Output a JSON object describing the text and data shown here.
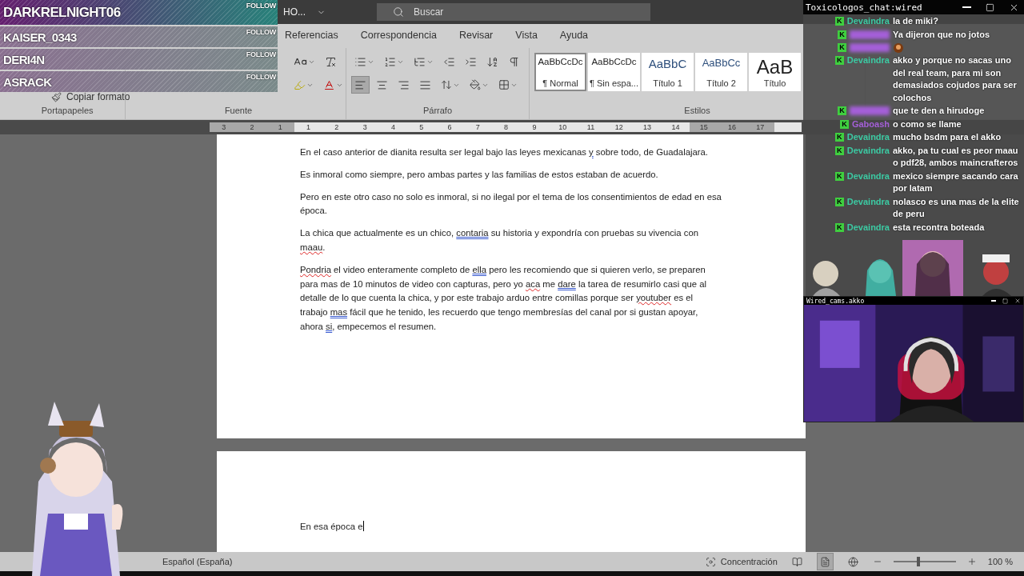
{
  "stream_overlay": {
    "followers": [
      {
        "name": "DARKRELNIGHT06",
        "action": "FOLLOW"
      },
      {
        "name": "KAISER_0343",
        "action": "FOLLOW"
      },
      {
        "name": "DERI4N",
        "action": "FOLLOW"
      },
      {
        "name": "ASRACK",
        "action": "FOLLOW"
      }
    ]
  },
  "word": {
    "account_menu": "HO...",
    "search": {
      "placeholder": "Buscar"
    },
    "tabs": [
      {
        "label": "Referencias",
        "selected": false
      },
      {
        "label": "Correspondencia",
        "selected": false
      },
      {
        "label": "Revisar",
        "selected": false
      },
      {
        "label": "Vista",
        "selected": false
      },
      {
        "label": "Ayuda",
        "selected": false
      }
    ],
    "ribbon": {
      "clipboard": {
        "title": "Portapapeles",
        "commands": [
          "Copiar formato"
        ]
      },
      "font": {
        "title": "Fuente"
      },
      "paragraph": {
        "title": "Párrafo",
        "alignments": [
          {
            "selected": true
          },
          {
            "selected": false
          },
          {
            "selected": false
          },
          {
            "selected": false
          }
        ]
      },
      "styles": {
        "title": "Estilos",
        "items": [
          {
            "preview": "AaBbCcDc",
            "label": "¶ Normal",
            "kind": "body",
            "selected": true
          },
          {
            "preview": "AaBbCcDc",
            "label": "¶ Sin espa...",
            "kind": "body",
            "selected": false
          },
          {
            "preview": "AaBbC",
            "label": "Título 1",
            "kind": "heading1",
            "selected": false
          },
          {
            "preview": "AaBbCc",
            "label": "Título 2",
            "kind": "heading2",
            "selected": false
          },
          {
            "preview": "AaB",
            "label": "Título",
            "kind": "title",
            "selected": false
          }
        ]
      }
    },
    "ruler": [
      "3",
      "2",
      "1",
      "1",
      "2",
      "3",
      "4",
      "5",
      "6",
      "7",
      "8",
      "9",
      "10",
      "11",
      "12",
      "13",
      "14",
      "15",
      "16",
      "17"
    ],
    "pages": [
      {
        "paragraphs": [
          [
            {
              "text": "En el caso anterior de dianita resulta ser legal bajo las leyes mexicanas "
            },
            {
              "text": "y",
              "grammar_flag": true
            },
            {
              "text": " sobre todo, de Guadalajara."
            }
          ],
          [
            {
              "text": "Es inmoral como siempre, pero ambas partes y las familias de estos estaban de acuerdo."
            }
          ],
          [
            {
              "text": "Pero en este otro caso no solo es inmoral, si no ilegal por el tema de los consentimientos de edad en esa época."
            }
          ],
          [
            {
              "text": "La chica que actualmente es un chico, "
            },
            {
              "text": "contaria",
              "grammar_flag": true
            },
            {
              "text": " su historia y expondría con pruebas su vivencia con "
            },
            {
              "text": "maau",
              "misspelled": true
            },
            {
              "text": "."
            }
          ],
          [
            {
              "text": "Pondria",
              "misspelled": true
            },
            {
              "text": " el video enteramente completo de "
            },
            {
              "text": "ella",
              "grammar_flag": true
            },
            {
              "text": " pero les recomiendo que si quieren verlo, se preparen para mas de 10 minutos de video con capturas, pero yo "
            },
            {
              "text": "aca",
              "misspelled": true
            },
            {
              "text": " me "
            },
            {
              "text": "dare",
              "grammar_flag": true
            },
            {
              "text": " la tarea de resumirlo casi que al detalle de lo que cuenta la chica, y por este trabajo arduo entre comillas porque ser "
            },
            {
              "text": "youtuber",
              "misspelled": true
            },
            {
              "text": " es el trabajo "
            },
            {
              "text": "mas",
              "grammar_flag": true
            },
            {
              "text": " fácil que he tenido, les recuerdo que tengo membresías del canal por si gustan apoyar, ahora "
            },
            {
              "text": "si",
              "grammar_flag": true
            },
            {
              "text": ", empecemos el resumen."
            }
          ]
        ]
      },
      {
        "paragraphs": [
          [
            {
              "text": "En esa época e"
            }
          ]
        ],
        "cursor": true
      }
    ],
    "status_bar": {
      "language": "Español (España)",
      "focus": "Concentración",
      "zoom": {
        "level": 0.4
      },
      "zoom_label": "100 %"
    }
  },
  "chat": {
    "title": "Toxicologos_chat:wired",
    "messages": [
      {
        "badge": "K",
        "name": "Devaindra",
        "color": "#3ccaa3",
        "kind": "text",
        "text": "la de miki?"
      },
      {
        "badge": "K",
        "color": "#a45fd8",
        "kind": "blurred",
        "text": "Ya dijeron que no jotos"
      },
      {
        "badge": "K",
        "color": "#a45fd8",
        "kind": "blurred_emote"
      },
      {
        "badge": "K",
        "name": "Devaindra",
        "color": "#3ccaa3",
        "kind": "text",
        "text": "akko y porque no sacas uno del real team, para mi son demasiados cojudos para ser colochos"
      },
      {
        "badge": "K",
        "color": "#a45fd8",
        "kind": "blurred",
        "text": "que te den a hirudoge"
      },
      {
        "badge": "K",
        "name": "Gaboash",
        "color": "#a45fd8",
        "kind": "text",
        "text": "o como se llame"
      },
      {
        "badge": "K",
        "name": "Devaindra",
        "color": "#3ccaa3",
        "kind": "text",
        "text": "mucho bsdm para el akko"
      },
      {
        "badge": "K",
        "name": "Devaindra",
        "color": "#3ccaa3",
        "kind": "text",
        "text": "akko, pa tu cual es peor maau o pdf28, ambos maincrafteros"
      },
      {
        "badge": "K",
        "name": "Devaindra",
        "color": "#3ccaa3",
        "kind": "text",
        "text": "mexico siempre sacando cara por latam"
      },
      {
        "badge": "K",
        "name": "Devaindra",
        "color": "#3ccaa3",
        "kind": "text",
        "text": "nolasco es una mas de la elite de peru"
      },
      {
        "badge": "K",
        "name": "Devaindra",
        "color": "#3ccaa3",
        "kind": "text",
        "text": "esta recontra boteada"
      }
    ]
  },
  "webcam": {
    "title": "Wired_cams.akko"
  }
}
